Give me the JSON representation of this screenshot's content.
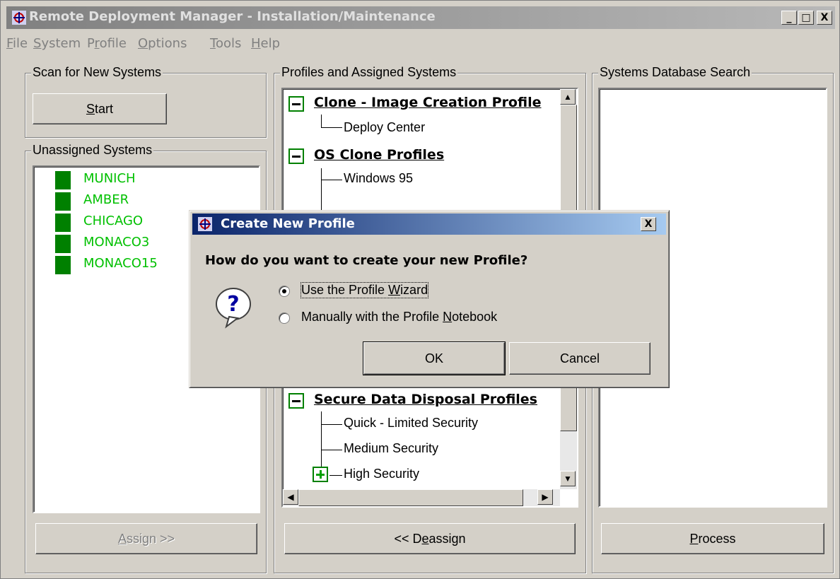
{
  "window": {
    "title": "Remote Deployment Manager - Installation/Maintenance",
    "controls": {
      "minimize": "_",
      "maximize": "□",
      "close": "X"
    }
  },
  "menu": [
    {
      "label": "File",
      "mnemonic": "F"
    },
    {
      "label": "System",
      "mnemonic": "S"
    },
    {
      "label": "Profile",
      "mnemonic": "r"
    },
    {
      "label": "Options",
      "mnemonic": "O"
    },
    {
      "label": "Tools",
      "mnemonic": "T"
    },
    {
      "label": "Help",
      "mnemonic": "H"
    }
  ],
  "scan": {
    "group_label": "Scan for New Systems",
    "start_button": {
      "mnemonic": "S",
      "rest": "tart"
    }
  },
  "unassigned": {
    "group_label": "Unassigned Systems",
    "systems": [
      "MUNICH",
      "AMBER",
      "CHICAGO",
      "MONACO3",
      "MONACO15"
    ],
    "assign_button": {
      "mnemonic": "A",
      "rest": "ssign >>"
    }
  },
  "profiles": {
    "group_label": "Profiles and Assigned Systems",
    "tree_top": [
      {
        "heading": "Clone - Image Creation Profile",
        "expander": "minus",
        "children": [
          "Deploy Center"
        ]
      },
      {
        "heading": "OS Clone Profiles",
        "expander": "minus",
        "children": [
          "Windows 95"
        ]
      }
    ],
    "tree_bottom": {
      "heading": "Secure Data Disposal Profiles",
      "expander": "minus",
      "children": [
        {
          "label": "Quick - Limited Security",
          "expander": null
        },
        {
          "label": "Medium Security",
          "expander": null
        },
        {
          "label": "High Security",
          "expander": "plus"
        }
      ]
    },
    "deassign_button": {
      "before": "<< D",
      "mnemonic": "e",
      "after": "assign"
    }
  },
  "search": {
    "group_label": "Systems Database Search",
    "process_button": {
      "mnemonic": "P",
      "rest": "rocess"
    }
  },
  "dialog": {
    "title": "Create New Profile",
    "close": "X",
    "question": "How do you want to create your new Profile?",
    "options": [
      {
        "before": "Use the Profile ",
        "mnemonic": "W",
        "after": "izard",
        "checked": true
      },
      {
        "before": "Manually with the Profile ",
        "mnemonic": "N",
        "after": "otebook",
        "checked": false
      }
    ],
    "ok_label": "OK",
    "cancel_label": "Cancel",
    "icon": "question-icon"
  },
  "colors": {
    "face": "#d4d0c8",
    "system_text": "#00c000",
    "dialog_title_start": "#0a246a",
    "dialog_title_end": "#a6caf0"
  }
}
